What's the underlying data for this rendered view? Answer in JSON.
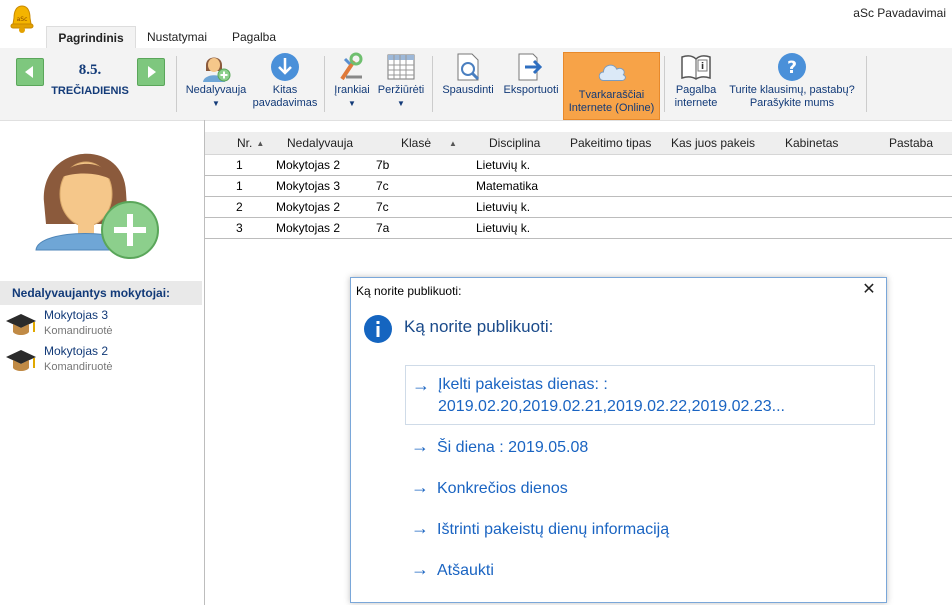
{
  "app": {
    "title": "aSc Pavadavimai",
    "logo_icon": "bell-icon"
  },
  "menu": {
    "tabs": [
      {
        "label": "Pagrindinis"
      },
      {
        "label": "Nustatymai"
      },
      {
        "label": "Pagalba"
      }
    ]
  },
  "date_nav": {
    "day_number": "8.5.",
    "day_name": "TREČIADIENIS",
    "prev_icon": "arrow-left-icon",
    "next_icon": "arrow-right-icon"
  },
  "ribbon": {
    "absent": "Nedalyvauja",
    "other_substitute": "Kitas pavadavimas",
    "tools": "Įrankiai",
    "view": "Peržiūrėti",
    "print": "Spausdinti",
    "export": "Eksportuoti",
    "online": "Tvarkaraščiai Internete (Online)",
    "help_online": "Pagalba internete",
    "questions": "Turite klausimų, pastabų? Parašykite mums",
    "online_color": "#f7a348"
  },
  "left_panel": {
    "absent_header": "Nedalyvaujantys mokytojai:",
    "teachers": [
      {
        "name": "Mokytojas 3",
        "status": "Komandiruotė"
      },
      {
        "name": "Mokytojas 2",
        "status": "Komandiruotė"
      }
    ]
  },
  "table": {
    "columns": [
      "Nr.",
      "Nedalyvauja",
      "Klasė",
      "Disciplina",
      "Pakeitimo tipas",
      "Kas juos pakeis",
      "Kabinetas",
      "Pastaba"
    ],
    "rows": [
      {
        "nr": "1",
        "teacher": "Mokytojas 2",
        "class": "7b",
        "subject": "Lietuvių k."
      },
      {
        "nr": "1",
        "teacher": "Mokytojas 3",
        "class": "7c",
        "subject": "Matematika"
      },
      {
        "nr": "2",
        "teacher": "Mokytojas 2",
        "class": "7c",
        "subject": "Lietuvių k."
      },
      {
        "nr": "3",
        "teacher": "Mokytojas 2",
        "class": "7a",
        "subject": "Lietuvių k."
      }
    ]
  },
  "dialog": {
    "caption": "Ką norite publikuoti:",
    "heading": "Ką norite publikuoti:",
    "close_symbol": "✕",
    "options": [
      {
        "line1": "Įkelti pakeistas dienas: :",
        "line2": "2019.02.20,2019.02.21,2019.02.22,2019.02.23..."
      },
      {
        "line1": "Ši diena : 2019.05.08"
      },
      {
        "line1": "Konkrečios dienos"
      },
      {
        "line1": "Ištrinti pakeistų dienų informaciją"
      },
      {
        "line1": "Atšaukti"
      }
    ],
    "arrow": "→",
    "link_color": "#1a64c2"
  }
}
